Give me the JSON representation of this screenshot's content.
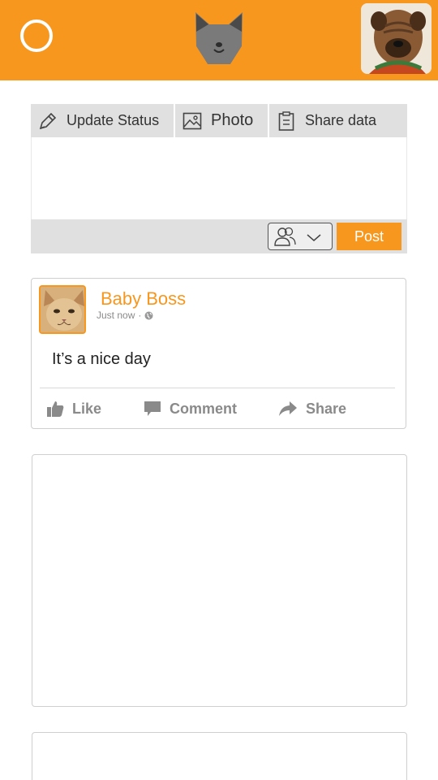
{
  "composer": {
    "tabs": [
      {
        "label": "Update Status",
        "icon": "pencil-icon"
      },
      {
        "label": "Photo",
        "icon": "image-icon"
      },
      {
        "label": "Share data",
        "icon": "clipboard-icon"
      }
    ],
    "audience_icon": "people-icon",
    "post_label": "Post"
  },
  "feed": {
    "post": {
      "author": "Baby Boss",
      "time": "Just now",
      "text": "It’s a nice day",
      "actions": {
        "like": "Like",
        "comment": "Comment",
        "share": "Share"
      }
    }
  },
  "colors": {
    "accent": "#f7971e",
    "header_bg": "#f7971e",
    "tab_bg": "#e0e0e0",
    "action_text": "#8a8a8a"
  }
}
